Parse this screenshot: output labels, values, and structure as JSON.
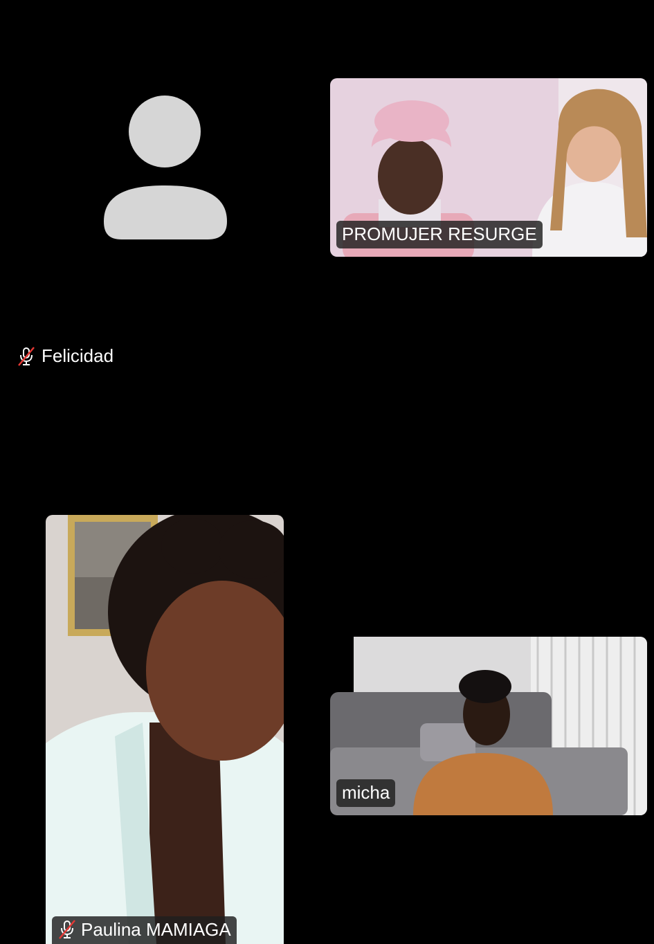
{
  "participants": {
    "felicidad": {
      "name": "Felicidad",
      "muted": true,
      "video": false,
      "avatar_icon": "person-silhouette-icon"
    },
    "promujer": {
      "name": "PROMUJER RESURGE",
      "muted": false,
      "video": true
    },
    "paulina": {
      "name": "Paulina MAMIAGA",
      "muted": true,
      "video": true
    },
    "micha": {
      "name": "micha",
      "muted": false,
      "video": true
    }
  },
  "icons": {
    "muted": "mic-muted-icon"
  },
  "colors": {
    "background": "#000000",
    "avatar": "#d6d6d6",
    "badge_bg": "#1e1e1e",
    "mute_slash": "#e53935"
  }
}
